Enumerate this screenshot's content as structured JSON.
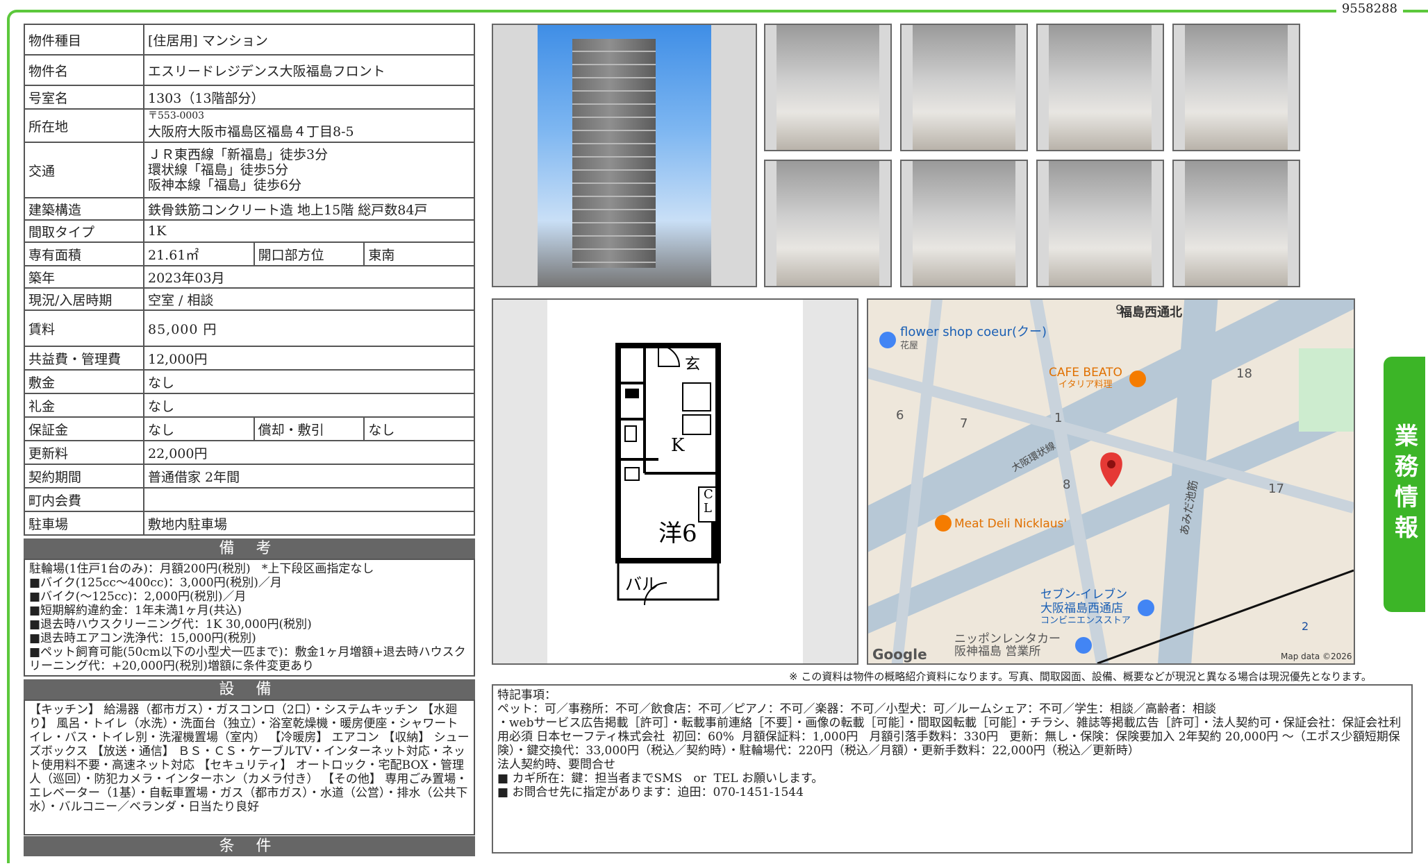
{
  "doc_id": "9558288",
  "side_tab": "業務情報",
  "info": {
    "type_label": "物件種目",
    "type_value": "[住居用]  マンション",
    "name_label": "物件名",
    "name_value": "エスリードレジデンス大阪福島フロント",
    "room_label": "号室名",
    "room_value": "1303（13階部分）",
    "addr_label": "所在地",
    "addr_zip": "〒553-0003",
    "addr_value": "大阪府大阪市福島区福島４丁目8-5",
    "access_label": "交通",
    "access_lines": [
      "ＪＲ東西線「新福島」徒歩3分",
      "環状線「福島」徒歩5分",
      "阪神本線「福島」徒歩6分"
    ],
    "structure_label": "建築構造",
    "structure_value": "鉄骨鉄筋コンクリート造  地上15階  総戸数84戸",
    "layout_label": "間取タイプ",
    "layout_value": "1K",
    "area_label": "専有面積",
    "area_value": "21.61㎡",
    "facing_label": "開口部方位",
    "facing_value": "東南",
    "built_label": "築年",
    "built_value": "2023年03月",
    "status_label": "現況/入居時期",
    "status_value": "空室  /  相談",
    "rent_label": "賃料",
    "rent_value": "85,000 円",
    "fee_label": "共益費・管理費",
    "fee_value": "12,000円",
    "deposit_label": "敷金",
    "deposit_value": "なし",
    "key_label": "礼金",
    "key_value": "なし",
    "guarantee_label": "保証金",
    "guarantee_value": "なし",
    "amort_label": "償却・敷引",
    "amort_value": "なし",
    "renewal_label": "更新料",
    "renewal_value": "22,000円",
    "contract_label": "契約期間",
    "contract_value": "普通借家  2年間",
    "town_label": "町内会費",
    "town_value": "",
    "parking_label": "駐車場",
    "parking_value": "敷地内駐車場"
  },
  "remarks_head": "備 考",
  "remarks_text": "駐輪場(1住戸1台のみ)：月額200円(税別)   *上下段区画指定なし\n■バイク(125cc～400cc)：3,000円(税別)／月\n■バイク(～125cc)：2,000円(税別)／月\n■短期解約違約金：1年未満1ヶ月(共込)\n■退去時ハウスクリーニング代：1K 30,000円(税別)\n■退去時エアコン洗浄代：15,000円(税別)\n■ペット飼育可能(50cm以下の小型犬一匹まで)：敷金1ヶ月増額+退去時ハウスクリーニング代：+20,000円(税別)増額に条件変更あり",
  "equip_head": "設 備",
  "equip_text": "【キッチン】 給湯器（都市ガス）・ガスコンロ（2口）・システムキッチン 【水廻り】 風呂・トイレ（水洗）・洗面台（独立）・浴室乾燥機・暖房便座・シャワートイレ・バス・トイレ別・洗濯機置場（室内） 【冷暖房】 エアコン 【収納】 シューズボックス 【放送・通信】 ＢＳ・ＣＳ・ケーブルTV・インターネット対応・ネット使用料不要・高速ネット対応 【セキュリティ】 オートロック・宅配BOX・管理人（巡回）・防犯カメラ・インターホン（カメラ付き） 【その他】 専用ごみ置場・エレベーター（1基）・自転車置場・ガス（都市ガス）・水道（公営）・排水（公共下水）・バルコニー／ベランダ・日当たり良好",
  "cond_head": "条 件",
  "plan_labels": {
    "entry": "玄",
    "kitchen": "K",
    "closet": "C\nL",
    "room": "洋6",
    "balcony": "バル"
  },
  "map": {
    "labels": [
      "福島西通北",
      "flower shop coeur(クー)",
      "花屋",
      "CAFE BEATO",
      "イタリア料理",
      "大阪環状線",
      "あみだ池筋",
      "Meat Deli Nicklaus'",
      "セブン-イレブン",
      "大阪福島西通店",
      "コンビニエンスストア",
      "ニッポンレンタカー",
      "阪神福島 営業所",
      "Google",
      "Map data ©2026"
    ],
    "numbers": [
      "9",
      "18",
      "6",
      "7",
      "1",
      "8",
      "17",
      "2"
    ]
  },
  "footnote": "※ この資料は物件の概略紹介資料になります。写真、間取図面、設備、概要などが現況と異なる場合は現況優先となります。",
  "special_text": "特記事項：\nペット：可／事務所：不可／飲食店：不可／ピアノ：不可／楽器：不可／小型犬：可／ルームシェア：不可／学生：相談／高齢者：相談\n・webサービス広告掲載［許可］・転載事前連絡［不要］・画像の転載［可能］・間取図転載［可能］・チラシ、雑誌等掲載広告［許可］・法人契約可・保証会社：保証会社利用必須 日本セーフティ株式会社  初回：60%  月額保証料：1,000円   月額引落手数料：330円   更新：無し・保険：保険要加入 2年契約 20,000円 ～（エポス少額短期保険）・鍵交換代：33,000円（税込／契約時）・駐輪場代：220円（税込／月額）・更新手数料：22,000円（税込／更新時）\n法人契約時、要問合せ\n■ カギ所在：鍵：担当者までSMS   or  TEL お願いします。\n■ お問合せ先に指定があります：迫田：070-1451-1544"
}
